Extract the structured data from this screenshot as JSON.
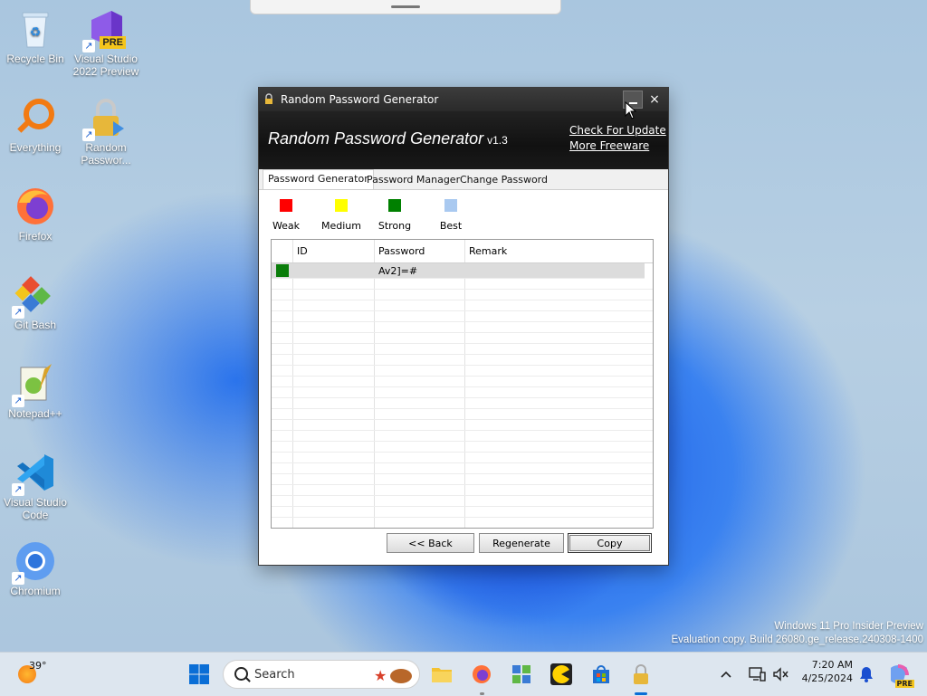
{
  "desktop": {
    "icons": [
      {
        "label": "Recycle Bin"
      },
      {
        "label": "Visual Studio 2022 Preview",
        "badge": "PRE"
      },
      {
        "label": "Everything"
      },
      {
        "label": "Random Passwor..."
      },
      {
        "label": "Firefox"
      },
      {
        "label": "Git Bash"
      },
      {
        "label": "Notepad++"
      },
      {
        "label": "Visual Studio Code"
      },
      {
        "label": "Chromium"
      }
    ],
    "shortcut_arrow": "↗"
  },
  "window": {
    "title": "Random Password Generator",
    "close_glyph": "×",
    "app_name": "Random Password Generator",
    "version": "v1.3",
    "check_update": "Check For Update",
    "more_freeware": "More Freeware",
    "tabs": [
      "Password Generator",
      "Password Manager",
      "Change Password"
    ],
    "active_tab": "Password Generator",
    "legend": [
      {
        "label": "Weak",
        "color": "#ff0000"
      },
      {
        "label": "Medium",
        "color": "#ffff00"
      },
      {
        "label": "Strong",
        "color": "#008000"
      },
      {
        "label": "Best",
        "color": "#a9c9f0"
      }
    ],
    "table": {
      "columns": [
        "ID",
        "Password",
        "Remark"
      ],
      "rows": [
        {
          "strength": "Strong",
          "id": "",
          "password": "Av2]=#",
          "remark": ""
        }
      ]
    },
    "buttons": {
      "back": "<< Back",
      "regenerate": "Regenerate",
      "copy": "Copy"
    }
  },
  "watermark": {
    "line1": "Windows 11 Pro Insider Preview",
    "line2": "Evaluation copy. Build 26080.ge_release.240308-1400"
  },
  "taskbar": {
    "weather_temp": "39°",
    "search_placeholder": "Search",
    "time": "7:20 AM",
    "date": "4/25/2024",
    "copilot_badge": "PRE"
  }
}
